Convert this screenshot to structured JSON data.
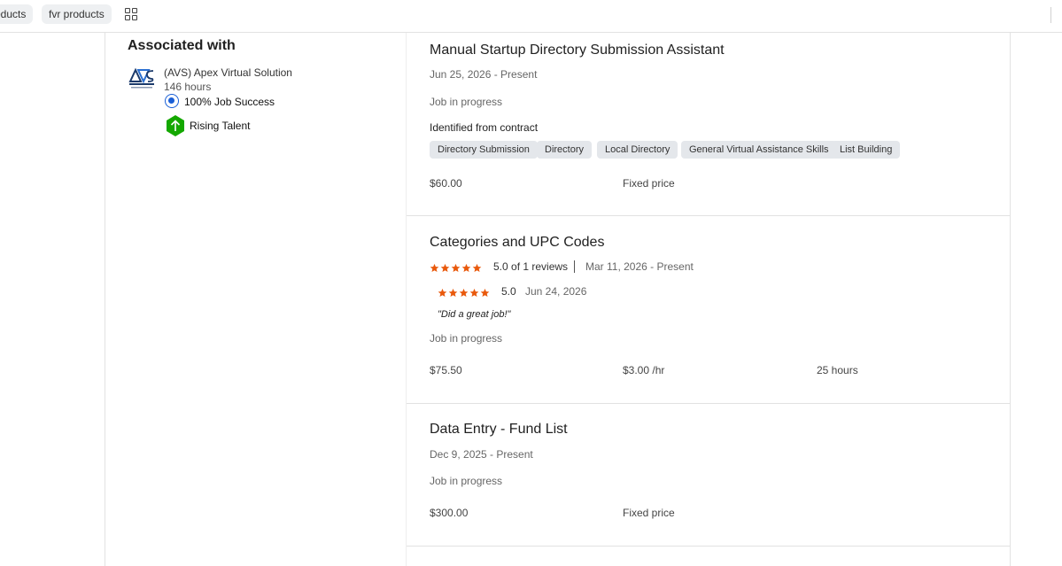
{
  "bookmarks": [
    {
      "label": "oducts"
    },
    {
      "label": "fvr products"
    }
  ],
  "sidebar": {
    "title": "Associated with",
    "agency_name": "(AVS) Apex Virtual Solution",
    "agency_hours": "146 hours",
    "job_success": "100% Job Success",
    "badge": "Rising Talent"
  },
  "jobs": [
    {
      "title": "Manual Startup Directory Submission Assistant",
      "date": "Jun 25, 2026 - Present",
      "status": "Job in progress",
      "identified": "Identified from contract",
      "tags": [
        "Directory Submission",
        "Directory",
        "Local Directory",
        "General Virtual Assistance Skills",
        "List Building"
      ],
      "amount": "$60.00",
      "type": "Fixed price"
    },
    {
      "title": "Categories and UPC Codes",
      "rating_summary": "5.0 of 1 reviews",
      "date": "Mar 11, 2026 - Present",
      "review_score": "5.0",
      "review_date": "Jun 24, 2026",
      "review_text": "\"Did a great job!\"",
      "status": "Job in progress",
      "amount": "$75.50",
      "rate": "$3.00 /hr",
      "hours": "25 hours",
      "rating": 5
    },
    {
      "title": "Data Entry - Fund List",
      "date": "Dec 9, 2025 - Present",
      "status": "Job in progress",
      "amount": "$300.00",
      "type": "Fixed price"
    }
  ],
  "colors": {
    "star": "#e9590c",
    "jss_blue": "#1a5fd6",
    "rising_green": "#14a800"
  }
}
